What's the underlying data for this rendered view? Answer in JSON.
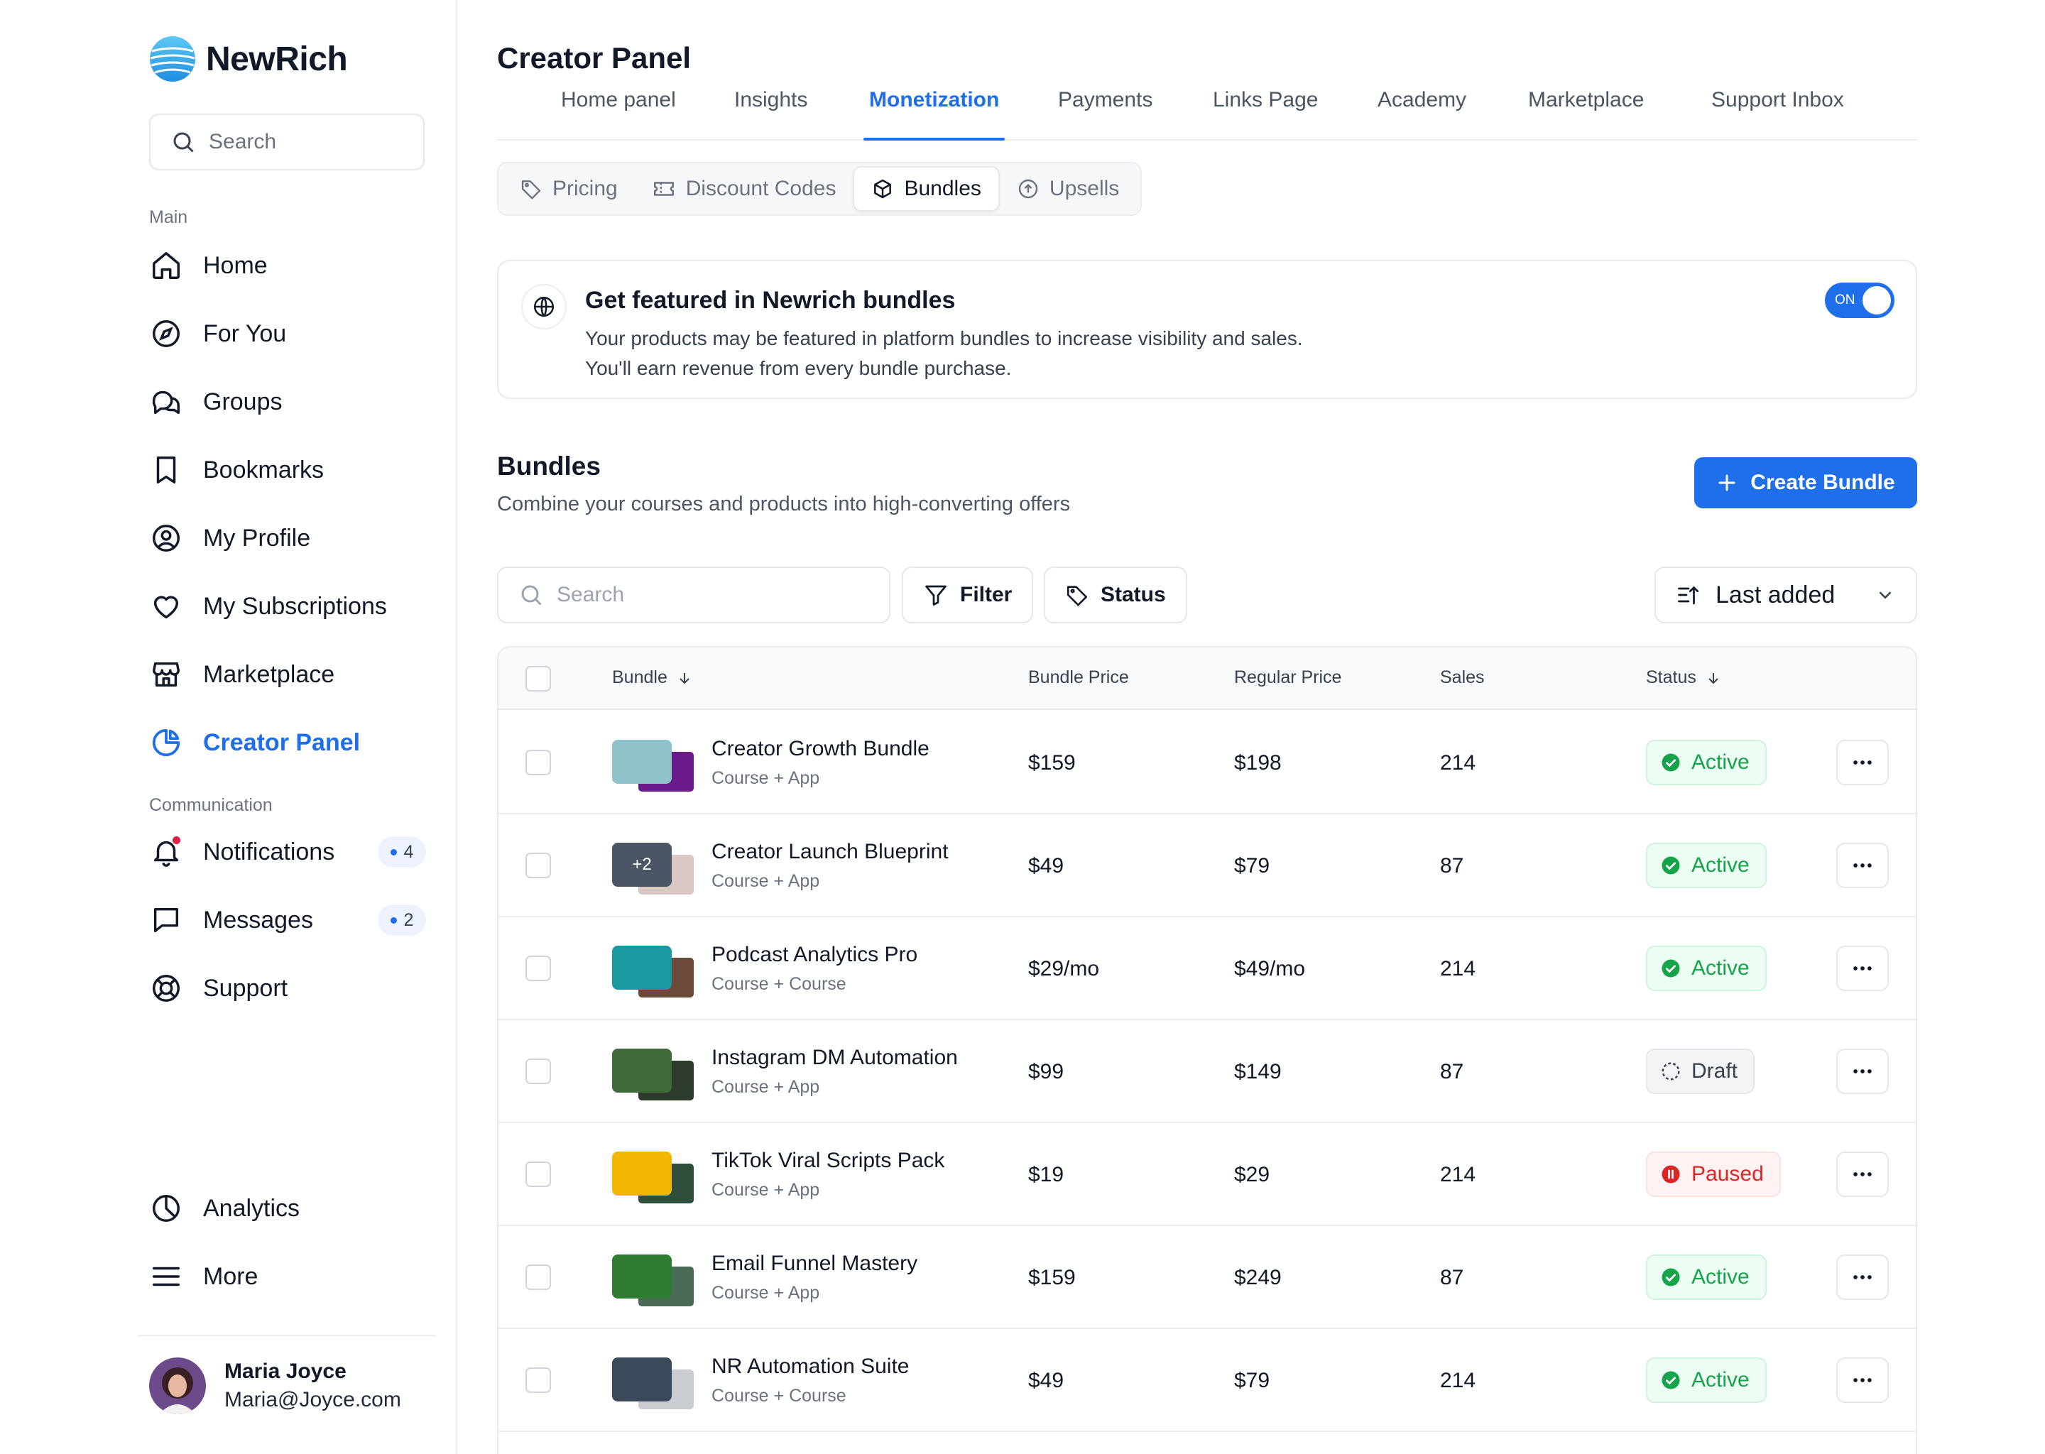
{
  "app": {
    "name": "NewRich"
  },
  "sidebar": {
    "search_placeholder": "Search",
    "section_main": "Main",
    "section_communication": "Communication",
    "items": {
      "home": "Home",
      "for_you": "For You",
      "groups": "Groups",
      "bookmarks": "Bookmarks",
      "my_profile": "My Profile",
      "my_subscriptions": "My Subscriptions",
      "marketplace": "Marketplace",
      "creator_panel": "Creator Panel",
      "notifications": "Notifications",
      "notifications_count": "4",
      "messages": "Messages",
      "messages_count": "2",
      "support": "Support",
      "analytics": "Analytics",
      "more": "More"
    },
    "user": {
      "name": "Maria Joyce",
      "email": "Maria@Joyce.com"
    }
  },
  "main": {
    "title": "Creator Panel",
    "tabs": [
      "Home panel",
      "Insights",
      "Monetization",
      "Payments",
      "Links Page",
      "Academy",
      "Marketplace",
      "Support Inbox"
    ],
    "active_tab": "Monetization",
    "subtabs": [
      "Pricing",
      "Discount Codes",
      "Bundles",
      "Upsells"
    ],
    "active_subtab": "Bundles",
    "feature": {
      "title": "Get featured in Newrich bundles",
      "line1": "Your products may be featured in platform bundles to increase visibility and sales.",
      "line2": "You'll earn revenue from every bundle purchase.",
      "toggle_label": "ON",
      "toggle_on": true
    },
    "bundles": {
      "title": "Bundles",
      "subtitle": "Combine your courses and products into high-converting offers",
      "create_label": "Create Bundle",
      "search_placeholder": "Search",
      "filter_label": "Filter",
      "status_label": "Status",
      "sort_label": "Last added",
      "columns": {
        "bundle": "Bundle",
        "bundle_price": "Bundle Price",
        "regular_price": "Regular Price",
        "sales": "Sales",
        "status": "Status"
      },
      "rows": [
        {
          "name": "Creator Growth Bundle",
          "type": "Course + App",
          "bundle_price": "$159",
          "regular_price": "$198",
          "sales": "214",
          "status": "Active",
          "thumb_a": "#8fc3c9",
          "thumb_b": "#6b1a8a"
        },
        {
          "name": "Creator Launch Blueprint",
          "type": "Course + App",
          "bundle_price": "$49",
          "regular_price": "$79",
          "sales": "87",
          "status": "Active",
          "extra": "+2",
          "thumb_a": "#4b5563",
          "thumb_b": "#d9c7c3"
        },
        {
          "name": "Podcast Analytics Pro",
          "type": "Course + Course",
          "bundle_price": "$29/mo",
          "regular_price": "$49/mo",
          "sales": "214",
          "status": "Active",
          "thumb_a": "#1a9aa0",
          "thumb_b": "#6b4a3a"
        },
        {
          "name": "Instagram DM Automation",
          "type": "Course + App",
          "bundle_price": "$99",
          "regular_price": "$149",
          "sales": "87",
          "status": "Draft",
          "thumb_a": "#3f6b3a",
          "thumb_b": "#2d3b2d"
        },
        {
          "name": "TikTok Viral Scripts Pack",
          "type": "Course + App",
          "bundle_price": "$19",
          "regular_price": "$29",
          "sales": "214",
          "status": "Paused",
          "thumb_a": "#f2b705",
          "thumb_b": "#2f4f3a"
        },
        {
          "name": "Email Funnel Mastery",
          "type": "Course + App",
          "bundle_price": "$159",
          "regular_price": "$249",
          "sales": "87",
          "status": "Active",
          "thumb_a": "#2e7d32",
          "thumb_b": "#4a6b55"
        },
        {
          "name": "NR Automation Suite",
          "type": "Course + Course",
          "bundle_price": "$49",
          "regular_price": "$79",
          "sales": "214",
          "status": "Active",
          "thumb_a": "#3a4a5a",
          "thumb_b": "#c9ccd1"
        }
      ]
    }
  },
  "colors": {
    "accent": "#1f6feb",
    "active": "#16a34a",
    "paused": "#dc2626"
  }
}
